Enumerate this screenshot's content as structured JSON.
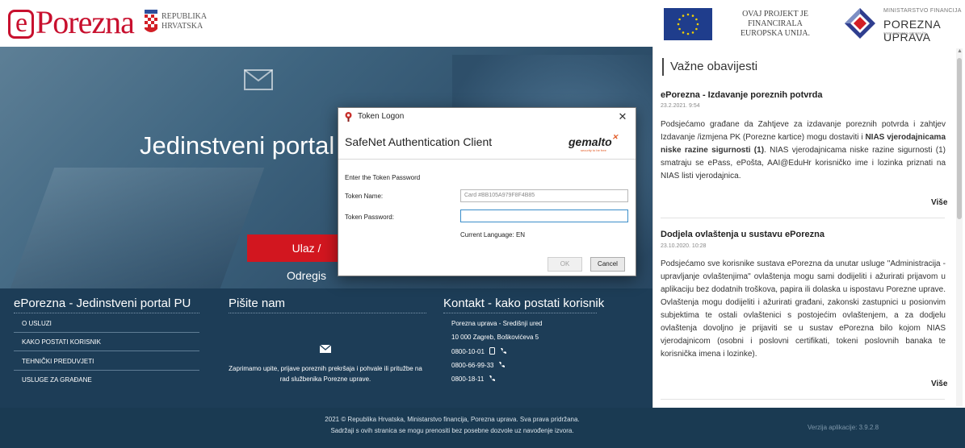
{
  "header": {
    "logo_text": "Porezna",
    "logo_e": "e",
    "republika_line1": "REPUBLIKA",
    "republika_line2": "HRVATSKA",
    "eu_line1": "OVAJ PROJEKT JE FINANCIRALA",
    "eu_line2": "EUROPSKA UNIJA.",
    "mf_small": "MINISTARSTVO FINANCIJA",
    "mf_big": "POREZNA UPRAVA",
    "mf_url": "www.porezna-uprava.hr"
  },
  "hero": {
    "title": "Jedinstveni portal",
    "button_label": "Ulaz / Odregis"
  },
  "footer_columns": {
    "col1_title": "ePorezna - Jedinstveni portal PU",
    "col1_links": [
      "O USLUZI",
      "KAKO POSTATI KORISNIK",
      "TEHNIČKI PREDUVJETI",
      "USLUGE ZA GRAĐANE"
    ],
    "col2_title": "Pišite nam",
    "col2_text": "Zaprimamo upite, prijave poreznih prekršaja i pohvale ili pritužbe na rad službenika Porezne uprave.",
    "col3_title": "Kontakt - kako postati korisnik",
    "col3_lines": [
      "Porezna uprava - Središnji ured",
      "10 000 Zagreb, Boškovićeva 5",
      "0800-10-01",
      "0800-66-99-33",
      "0800-18-11"
    ]
  },
  "bottom": {
    "line1": "2021 © Republika Hrvatska, Ministarstvo financija, Porezna uprava. Sva prava pridržana.",
    "line2": "Sadržaji s ovih stranica se mogu prenositi bez posebne dozvole uz navođenje izvora.",
    "version": "Verzija aplikacije: 3.9.2.8"
  },
  "news": {
    "heading": "Važne obavijesti",
    "items": [
      {
        "title": "ePorezna - Izdavanje poreznih potvrda",
        "date": "23.2.2021. 9:54",
        "body_a": "Podsjećamo građane da Zahtjeve za izdavanje poreznih potvrda i zahtjev Izdavanje /izmjena PK (Porezne kartice) mogu dostaviti i ",
        "body_bold": "NIAS vjerodajnicama niske razine sigurnosti (1)",
        "body_b": ". NIAS vjerodajnicama niske razine sigurnosti (1) smatraju se ePass, ePošta, AAI@EduHr korisničko ime i lozinka priznati na NIAS listi vjerodajnica.",
        "more": "Više"
      },
      {
        "title": "Dodjela ovlaštenja u sustavu ePorezna",
        "date": "23.10.2020. 10:28",
        "body": "Podsjećamo sve korisnike sustava ePorezna da unutar usluge \"Administracija - upravljanje ovlaštenjima\" ovlaštenja mogu sami dodijeliti i ažurirati prijavom u aplikaciju bez dodatnih troškova, papira ili dolaska u ispostavu Porezne uprave. Ovlaštenja mogu dodijeliti i ažurirati građani, zakonski zastupnici u posionvim subjektima te ostali ovlaštenici s postojećim ovlaštenjem, a za dodjelu ovlaštenja dovoljno je prijaviti se u sustav ePorezna bilo kojom NIAS vjerodajnicom (osobni i poslovni certifikati, tokeni poslovnih banaka te korisnička imena i lozinke).",
        "more": "Više"
      }
    ]
  },
  "dialog": {
    "window_title": "Token Logon",
    "client_name": "SafeNet Authentication Client",
    "brand": "gemalto",
    "brand_tagline": "security to be free",
    "prompt": "Enter the Token Password",
    "token_name_label": "Token Name:",
    "token_name_value": "Card #BB105A979F8F4B85",
    "token_password_label": "Token Password:",
    "token_password_value": "",
    "current_language_label": "Current Language:",
    "current_language_value": "EN",
    "ok_label": "OK",
    "cancel_label": "Cancel"
  },
  "colors": {
    "brand_red": "#c8102e",
    "button_red": "#d2161f",
    "footer_blue": "#1d3d57",
    "focus_blue": "#3b8ec9"
  }
}
